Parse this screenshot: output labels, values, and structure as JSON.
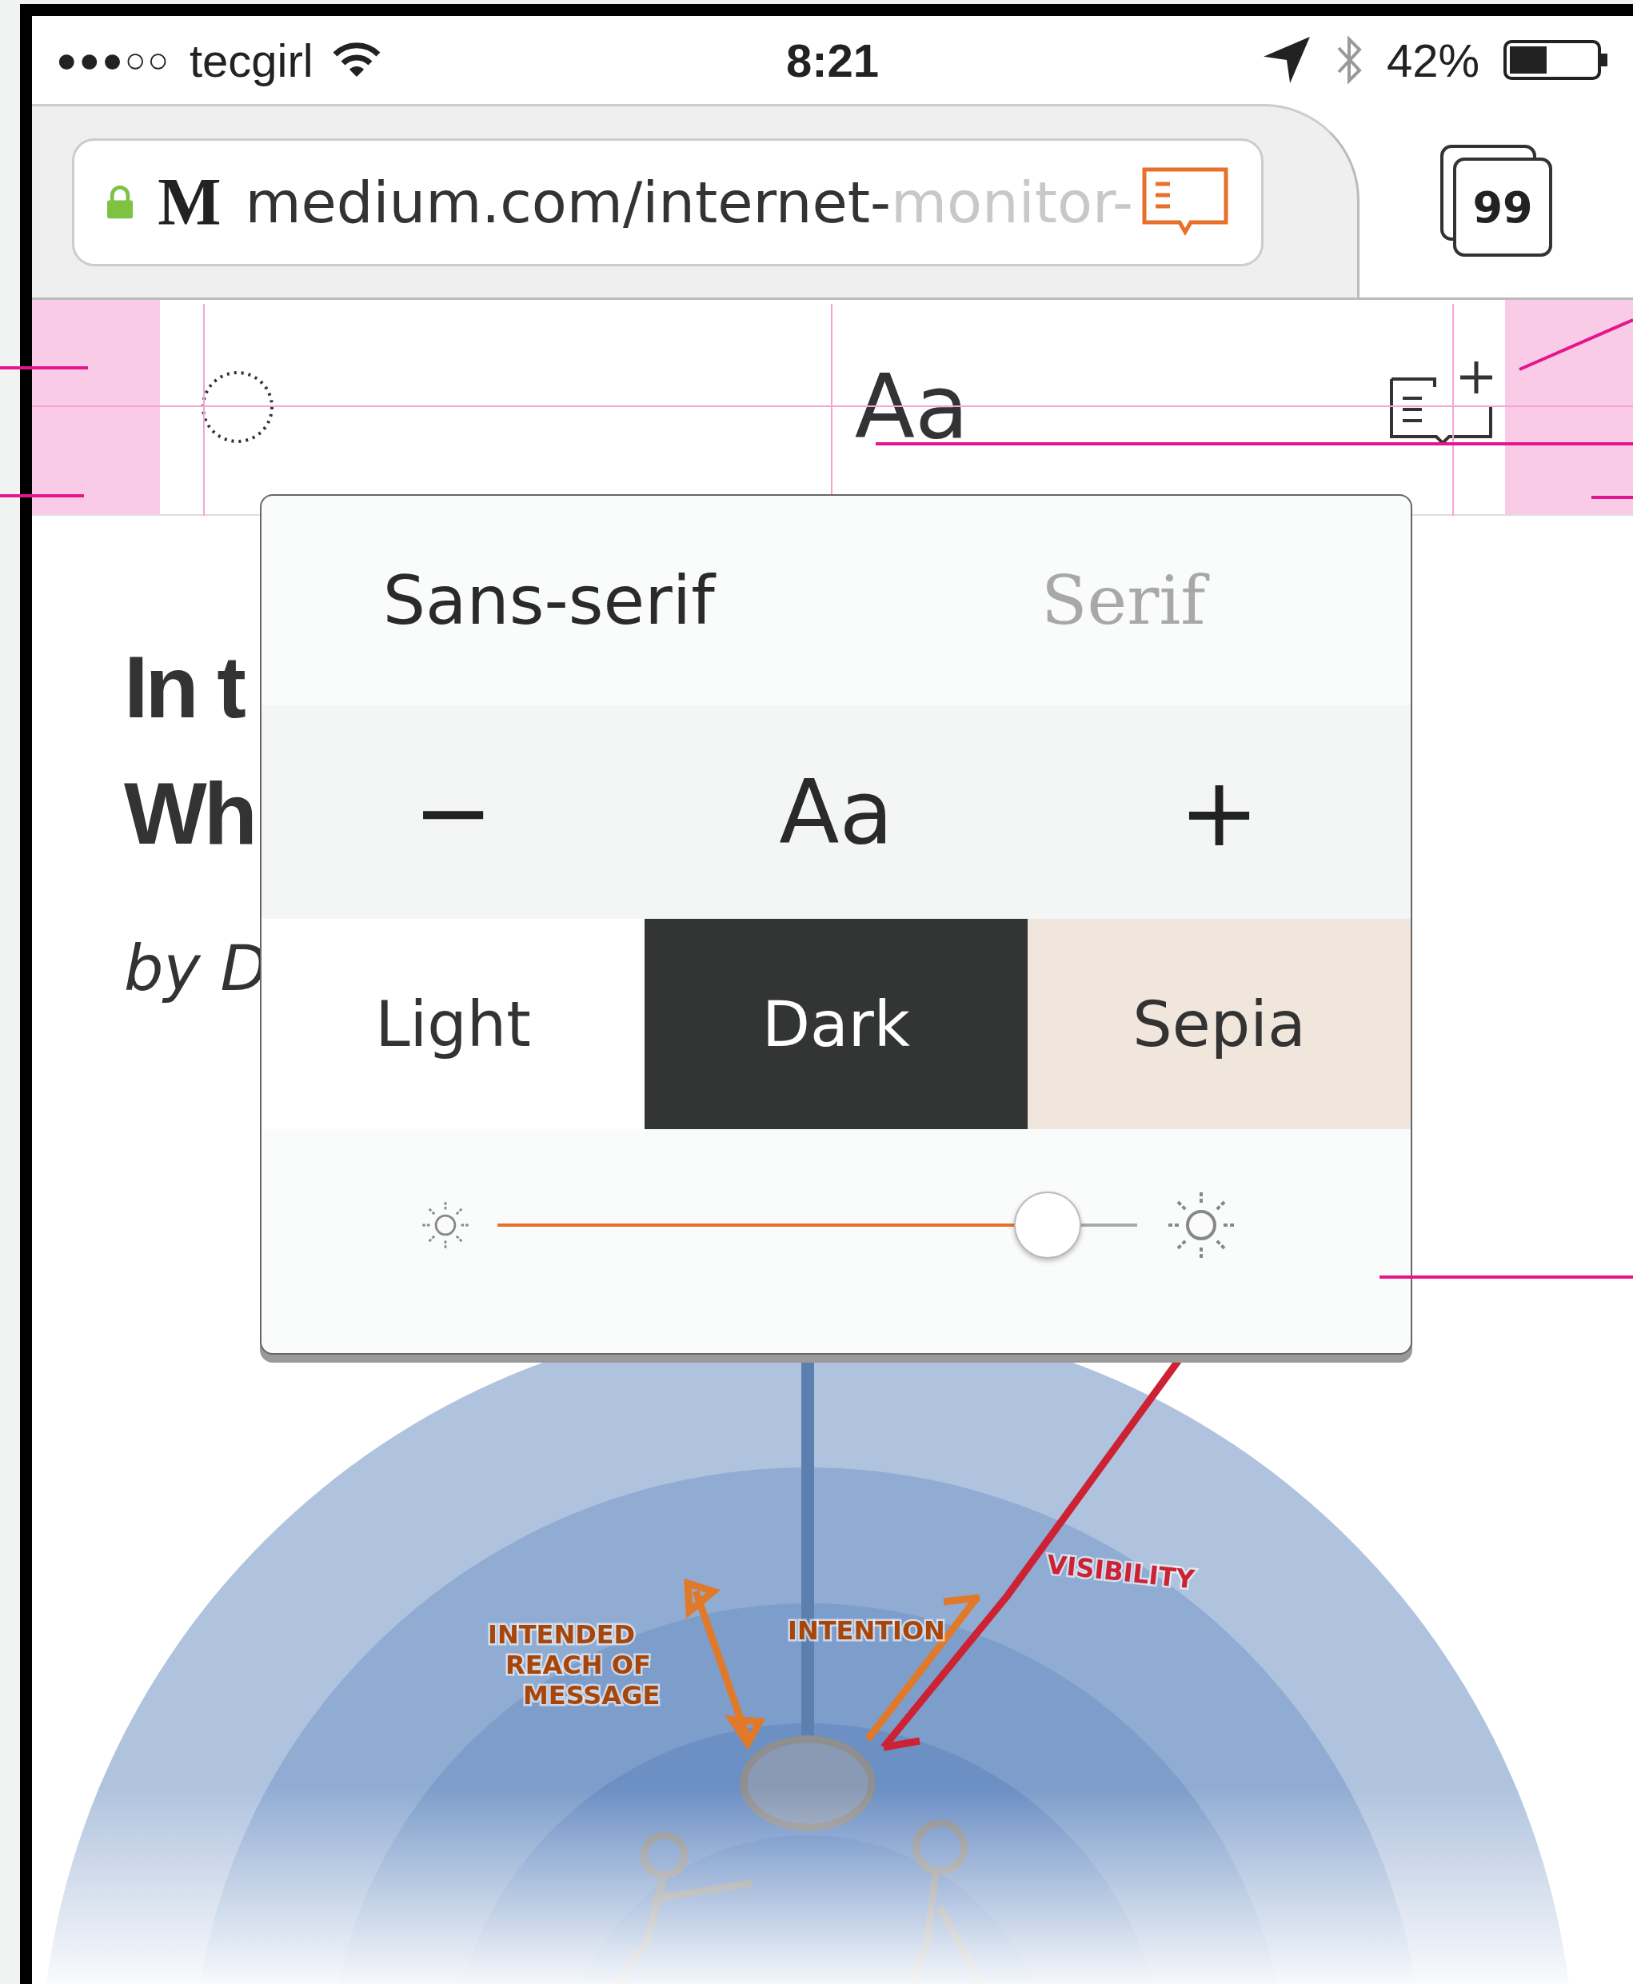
{
  "status_bar": {
    "signal": "●●●○○",
    "carrier": "tecgirl",
    "time": "8:21",
    "battery": "42%"
  },
  "address_bar": {
    "logo": "M",
    "url": "medium.com/internet-",
    "url_faded": "monitor-"
  },
  "tabs_button": {
    "count": "99"
  },
  "toolbar": {
    "font_button": "Aa"
  },
  "article": {
    "title_lines": [
      "In t",
      "Wh"
    ],
    "byline": "by D"
  },
  "reader_settings": {
    "fonts": [
      {
        "label": "Sans-serif",
        "kind": "sans",
        "selected": true
      },
      {
        "label": "Serif",
        "kind": "serif",
        "selected": false
      }
    ],
    "size": {
      "decrease": "−",
      "sample": "Aa",
      "increase": "+"
    },
    "themes": [
      {
        "label": "Light",
        "kind": "light"
      },
      {
        "label": "Dark",
        "kind": "dark"
      },
      {
        "label": "Sepia",
        "kind": "sepia"
      }
    ],
    "brightness": {
      "level": 0.86
    }
  },
  "illustration": {
    "labels": [
      {
        "lines": [
          "INTENDED",
          "REACH OF",
          "MESSAGE"
        ],
        "color": "#a8450a"
      },
      {
        "lines": [
          "INTENTION"
        ],
        "color": "#a8450a"
      },
      {
        "lines": [
          "VISIBILITY"
        ],
        "color": "#cc2233"
      }
    ]
  }
}
